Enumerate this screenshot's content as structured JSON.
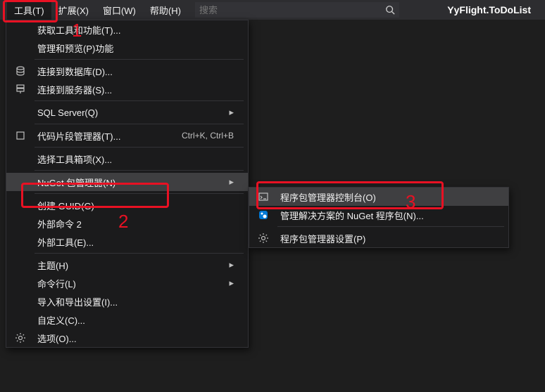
{
  "menubar": {
    "items": [
      "工具(T)",
      "扩展(X)",
      "窗口(W)",
      "帮助(H)"
    ]
  },
  "search": {
    "placeholder": "搜索"
  },
  "project": {
    "name": "YyFlight.ToDoList"
  },
  "dropdown": {
    "items": [
      {
        "label": "获取工具和功能(T)..."
      },
      {
        "label": "管理和预览(P)功能"
      },
      {
        "sep": true
      },
      {
        "label": "连接到数据库(D)...",
        "icon": "db"
      },
      {
        "label": "连接到服务器(S)...",
        "icon": "server"
      },
      {
        "sep": true
      },
      {
        "label": "SQL Server(Q)",
        "arrow": true
      },
      {
        "sep": true
      },
      {
        "label": "代码片段管理器(T)...",
        "shortcut": "Ctrl+K, Ctrl+B",
        "icon": "snippet"
      },
      {
        "sep": true
      },
      {
        "label": "选择工具箱项(X)..."
      },
      {
        "sep": true
      },
      {
        "label": "NuGet 包管理器(N)",
        "arrow": true,
        "hover": true
      },
      {
        "sep": true
      },
      {
        "label": "创建 GUID(G)"
      },
      {
        "label": "外部命令 2"
      },
      {
        "label": "外部工具(E)..."
      },
      {
        "sep": true
      },
      {
        "label": "主题(H)",
        "arrow": true
      },
      {
        "label": "命令行(L)",
        "arrow": true
      },
      {
        "label": "导入和导出设置(I)..."
      },
      {
        "label": "自定义(C)..."
      },
      {
        "label": "选项(O)...",
        "icon": "gear"
      }
    ]
  },
  "submenu": {
    "items": [
      {
        "label": "程序包管理器控制台(O)",
        "icon": "console",
        "hover": true
      },
      {
        "label": "管理解决方案的 NuGet 程序包(N)...",
        "icon": "nuget"
      },
      {
        "sep": true
      },
      {
        "label": "程序包管理器设置(P)",
        "icon": "gear"
      }
    ]
  },
  "annotations": {
    "n1": "1",
    "n2": "2",
    "n3": "3"
  }
}
